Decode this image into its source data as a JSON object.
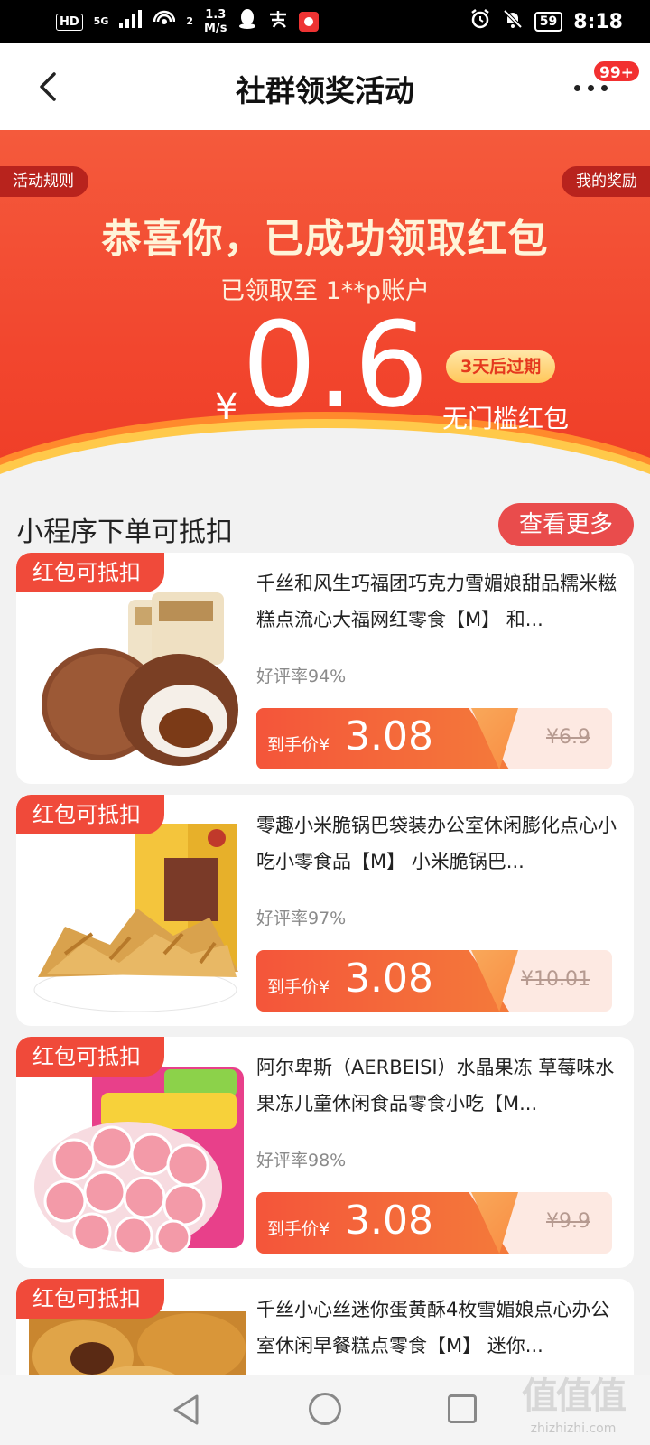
{
  "status_bar": {
    "hd": "HD",
    "network": "5G",
    "signal_extra": "2",
    "speed_value": "1.3",
    "speed_unit": "M/s",
    "battery": "59",
    "time": "8:18"
  },
  "header": {
    "title": "社群领奖活动",
    "badge": "99+"
  },
  "banner": {
    "rules_label": "活动规则",
    "rewards_label": "我的奖励",
    "congrats": "恭喜你，已成功领取红包",
    "account_line": "已领取至 1**p账户",
    "currency": "¥",
    "amount": "0.6",
    "expire": "3天后过期",
    "coupon_type": "无门槛红包"
  },
  "section": {
    "title": "小程序下单可抵扣",
    "more_label": "查看更多"
  },
  "products": [
    {
      "tag": "红包可抵扣",
      "title": "千丝和风生巧福团巧克力雪媚娘甜品糯米糍糕点流心大福网红零食【M】 和...",
      "rating": "好评率94%",
      "price_label": "到手价¥",
      "price": "3.08",
      "original_price": "¥6.9",
      "image": "mochi-product"
    },
    {
      "tag": "红包可抵扣",
      "title": "零趣小米脆锅巴袋装办公室休闲膨化点心小吃小零食品【M】 小米脆锅巴...",
      "rating": "好评率97%",
      "price_label": "到手价¥",
      "price": "3.08",
      "original_price": "¥10.01",
      "image": "crispy-rice-product"
    },
    {
      "tag": "红包可抵扣",
      "title": "阿尔卑斯（AERBEISI）水晶果冻 草莓味水果冻儿童休闲食品零食小吃【M...",
      "rating": "好评率98%",
      "price_label": "到手价¥",
      "price": "3.08",
      "original_price": "¥9.9",
      "image": "jelly-product"
    },
    {
      "tag": "红包可抵扣",
      "title": "千丝小心丝迷你蛋黄酥4枚雪媚娘点心办公室休闲早餐糕点零食【M】 迷你...",
      "image": "egg-yolk-pastry-product"
    }
  ],
  "watermark": {
    "big": "值值值",
    "small": "zhizhizhi.com"
  },
  "colors": {
    "accent_red": "#f04a3a",
    "banner_orange": "#f45a3c",
    "gold": "#ffc75a"
  }
}
